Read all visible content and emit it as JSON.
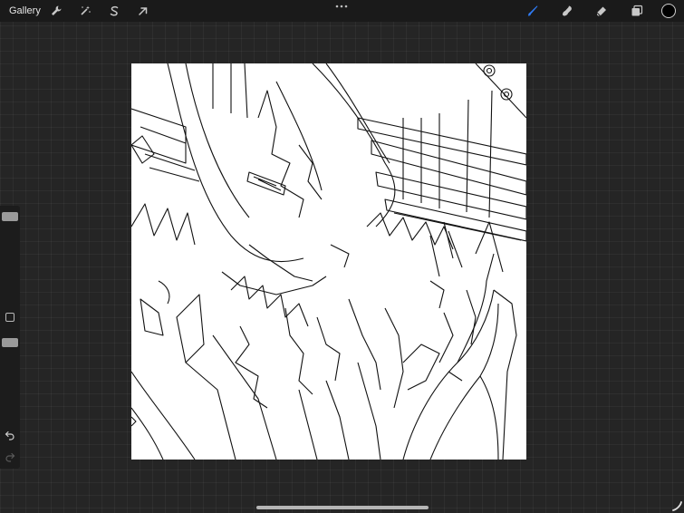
{
  "app": {
    "gallery_label": "Gallery"
  },
  "toolbar_left": [
    {
      "name": "actions-wrench-icon"
    },
    {
      "name": "adjustments-magic-wand-icon"
    },
    {
      "name": "selection-s-icon"
    },
    {
      "name": "transform-arrow-icon"
    }
  ],
  "toolbar_right": [
    {
      "name": "brush-icon",
      "active": true
    },
    {
      "name": "smudge-icon"
    },
    {
      "name": "eraser-icon"
    },
    {
      "name": "layers-icon"
    }
  ],
  "colors": {
    "accent": "#2f7bf5",
    "current_color": "#000000",
    "canvas_bg": "#ffffff",
    "ui_bg": "#252525"
  },
  "sidebar": {
    "brush_size_level": 0.05,
    "opacity_level": 0.0,
    "undo_icon": "undo-icon",
    "redo_icon": "redo-icon"
  }
}
